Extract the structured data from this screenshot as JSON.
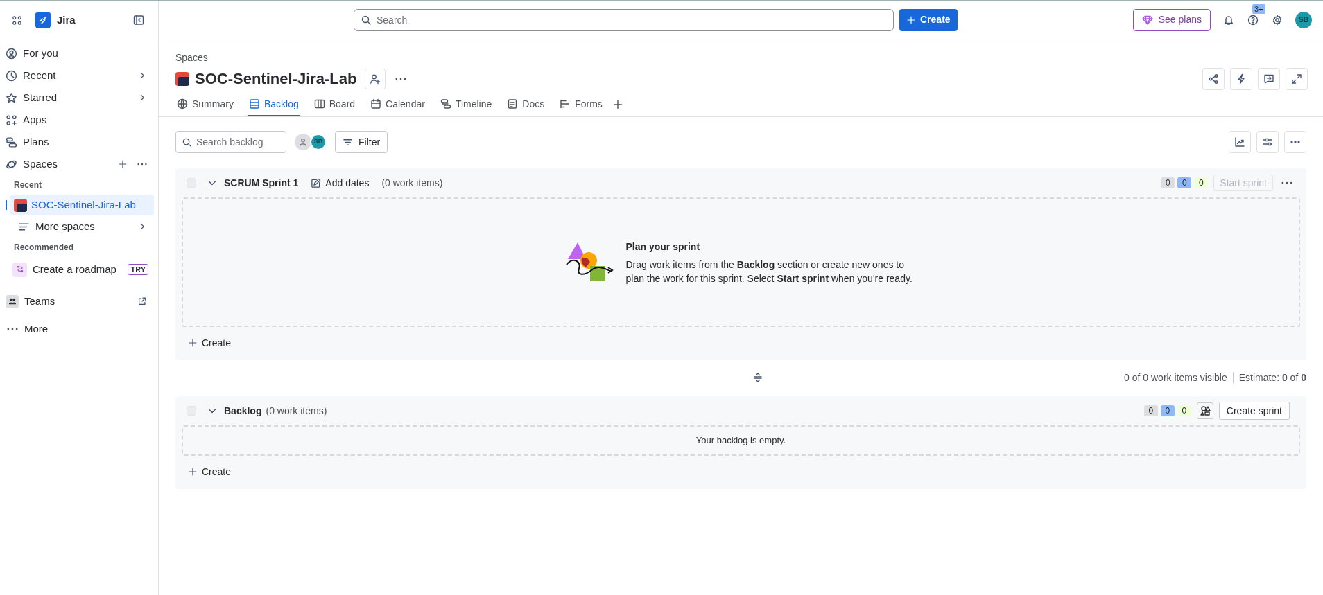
{
  "sidebar": {
    "app_name": "Jira",
    "nav": [
      {
        "label": "For you",
        "submenu": false
      },
      {
        "label": "Recent",
        "submenu": true
      },
      {
        "label": "Starred",
        "submenu": true
      },
      {
        "label": "Apps",
        "submenu": false
      },
      {
        "label": "Plans",
        "submenu": false
      }
    ],
    "spaces": {
      "label": "Spaces",
      "recent_heading": "Recent",
      "items": [
        {
          "label": "SOC-Sentinel-Jira-Lab",
          "selected": true
        }
      ],
      "more": "More spaces",
      "recommended_heading": "Recommended",
      "recommended": [
        {
          "label": "Create a roadmap",
          "badge": "TRY"
        }
      ]
    },
    "bottom": [
      {
        "label": "Teams"
      },
      {
        "label": "More"
      }
    ]
  },
  "topbar": {
    "search": {
      "placeholder": "Search"
    },
    "create_button": "Create",
    "see_plans": "See plans",
    "help_badge": "3+",
    "avatar": "SB"
  },
  "space": {
    "breadcrumb": "Spaces",
    "title": "SOC-Sentinel-Jira-Lab",
    "tabs": [
      {
        "label": "Summary",
        "selected": false
      },
      {
        "label": "Backlog",
        "selected": true
      },
      {
        "label": "Board",
        "selected": false
      },
      {
        "label": "Calendar",
        "selected": false
      },
      {
        "label": "Timeline",
        "selected": false
      },
      {
        "label": "Docs",
        "selected": false
      },
      {
        "label": "Forms",
        "selected": false
      }
    ]
  },
  "toolbar": {
    "search": {
      "placeholder": "Search backlog"
    },
    "avatar": "SB",
    "filter": "Filter"
  },
  "sprint": {
    "name": "SCRUM Sprint 1",
    "checked": false,
    "expanded": true,
    "add_dates": "Add dates",
    "count": "(0 work items)",
    "status_counts": [
      {
        "value": "0",
        "color": "#dddee1"
      },
      {
        "value": "0",
        "color": "#8fb8f6"
      },
      {
        "value": "0",
        "color": "#efffd6"
      }
    ],
    "start_button": {
      "label": "Start sprint",
      "disabled": true
    },
    "empty": {
      "title": "Plan your sprint",
      "text": "Drag work items from the **Backlog** section or create new ones to plan the work for this sprint. Select **Start sprint** when you're ready."
    },
    "create": "Create"
  },
  "summary": {
    "visible": "0 of 0 work items visible",
    "estimate": "Estimate: **0** of **0**"
  },
  "backlog": {
    "name": "Backlog",
    "checked": false,
    "expanded": true,
    "count": "(0 work items)",
    "status_counts": [
      {
        "value": "0",
        "color": "#dddee1"
      },
      {
        "value": "0",
        "color": "#8fb8f6"
      },
      {
        "value": "0",
        "color": "#efffd6"
      }
    ],
    "create_sprint": "Create sprint",
    "empty": "Your backlog is empty.",
    "create": "Create"
  }
}
